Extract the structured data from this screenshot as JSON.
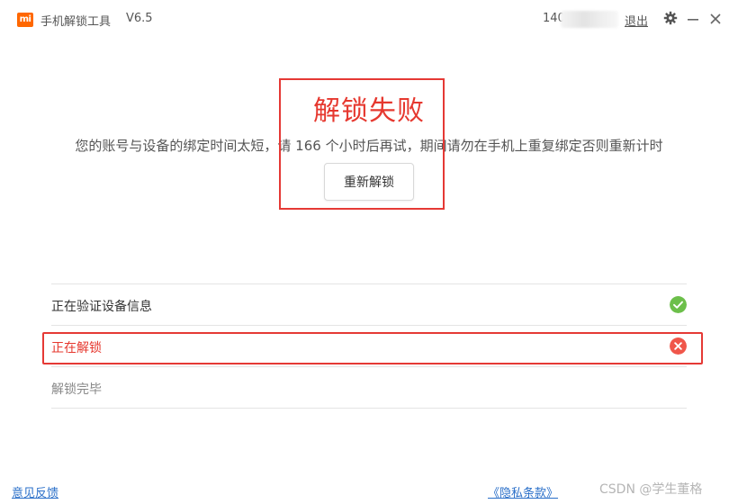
{
  "titlebar": {
    "logo_text": "mi",
    "app_title": "手机解锁工具",
    "version": "V6.5",
    "account_prefix": "140",
    "logout_label": "退出"
  },
  "result": {
    "title": "解锁失败",
    "message": "您的账号与设备的绑定时间太短，请 166 个小时后再试，期间请勿在手机上重复绑定否则重新计时",
    "retry_label": "重新解锁"
  },
  "steps": [
    {
      "label": "正在验证设备信息",
      "status": "success",
      "color": "#333333",
      "icon_color": "#6cbf4a"
    },
    {
      "label": "正在解锁",
      "status": "failed",
      "color": "#e6382f",
      "icon_color": "#f0564a"
    },
    {
      "label": "解锁完毕",
      "status": "pending",
      "color": "#888888"
    }
  ],
  "footer": {
    "feedback_label": "意见反馈",
    "privacy_label": "《隐私条款》",
    "watermark": "CSDN @学生董格"
  },
  "colors": {
    "accent": "#ff6700",
    "error": "#e6382f",
    "success": "#6cbf4a",
    "link": "#2a6fc9"
  }
}
